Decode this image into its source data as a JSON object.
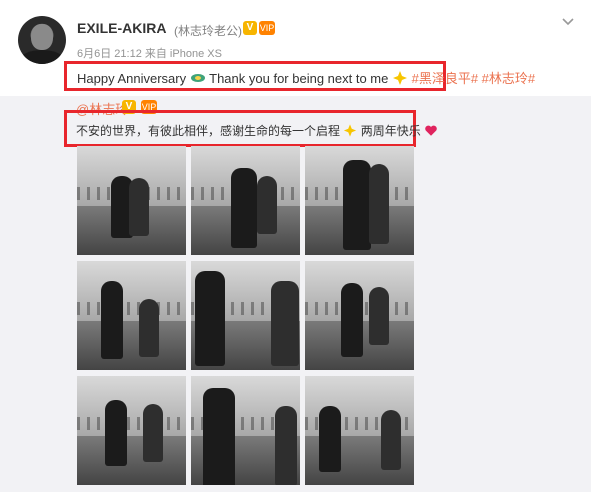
{
  "post": {
    "username": "EXILE-AKIRA",
    "nickname": "(林志玲老公)",
    "badge_v": "V",
    "badge_vip": "VIP",
    "meta": "6月6日 21:12 来自 iPhone XS",
    "text_part1": "Happy Anniversary",
    "text_part2": " Thank you for being next to me",
    "tags": "#黑泽良平# #林志玲#"
  },
  "repost": {
    "user": "@林志玲",
    "badge_v": "V",
    "badge_vip": "VIP",
    "text": "不安的世界，有彼此相伴，感谢生命的每一个启程",
    "text_tail": "两周年快乐"
  },
  "photos": [
    {
      "name": "photo-1"
    },
    {
      "name": "photo-2"
    },
    {
      "name": "photo-3"
    },
    {
      "name": "photo-4"
    },
    {
      "name": "photo-5"
    },
    {
      "name": "photo-6"
    },
    {
      "name": "photo-7"
    },
    {
      "name": "photo-8"
    },
    {
      "name": "photo-9"
    }
  ],
  "colors": {
    "highlight": "#e8262c",
    "link": "#eb7350",
    "repost_bg": "#f2f2f5"
  }
}
